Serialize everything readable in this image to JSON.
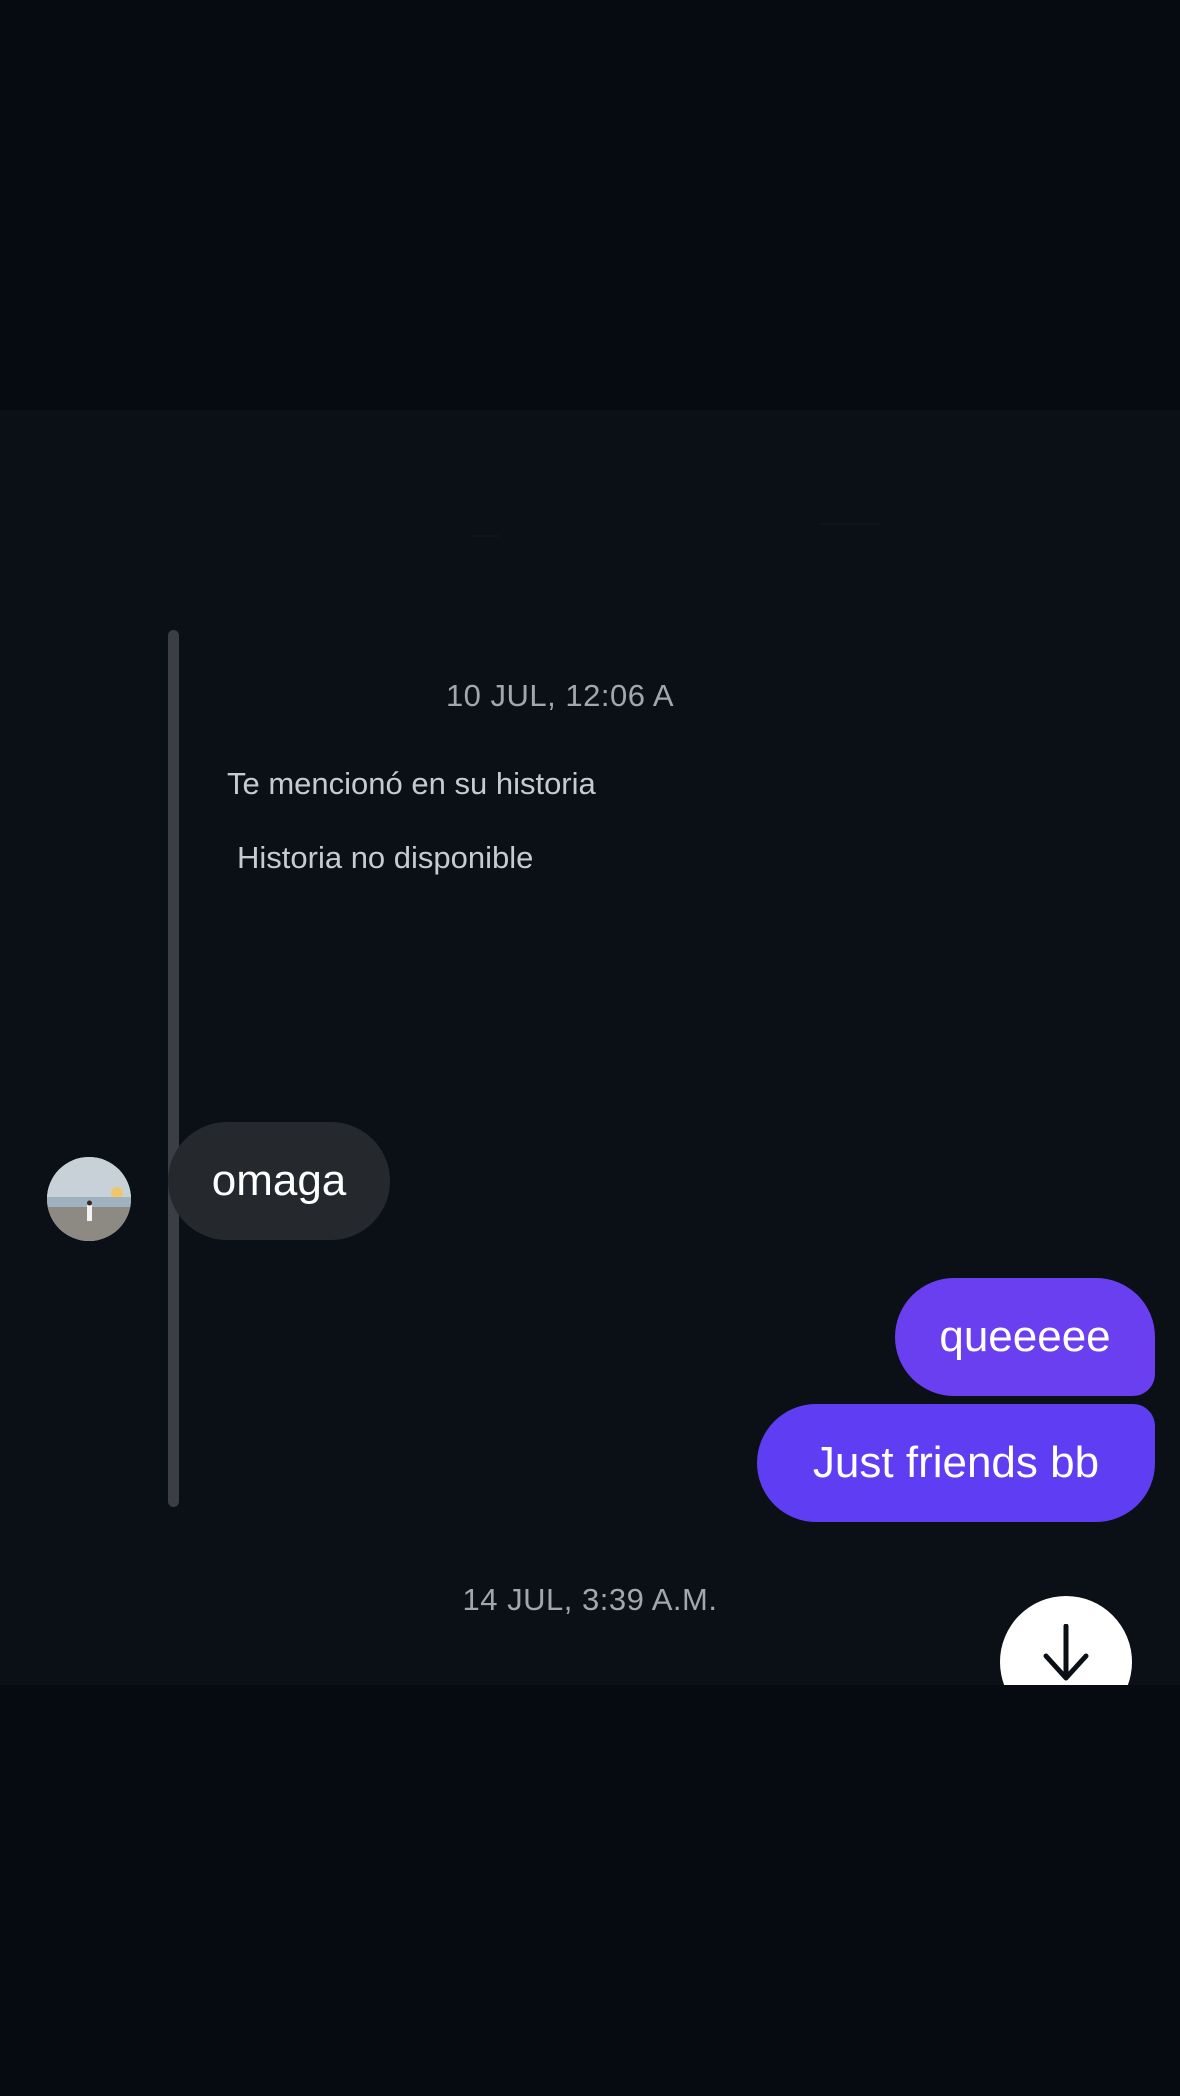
{
  "conversation": {
    "story_reply": {
      "timestamp": "10 JUL, 12:06 A",
      "note": "Te mencionó en su historia",
      "unavailable": "Historia no disponible"
    },
    "messages": [
      {
        "direction": "incoming",
        "text": "omaga"
      },
      {
        "direction": "outgoing",
        "text": "queeeee"
      },
      {
        "direction": "outgoing",
        "text": "Just friends bb"
      }
    ],
    "second_timestamp": "14 JUL, 3:39 A.M."
  },
  "controls": {
    "scroll_down_icon": "arrow-down-icon"
  },
  "colors": {
    "outgoing_bubble": "#6a3ff0",
    "incoming_bubble": "#25292e",
    "background": "#0b1016",
    "dim_overlay": "#060b11"
  }
}
